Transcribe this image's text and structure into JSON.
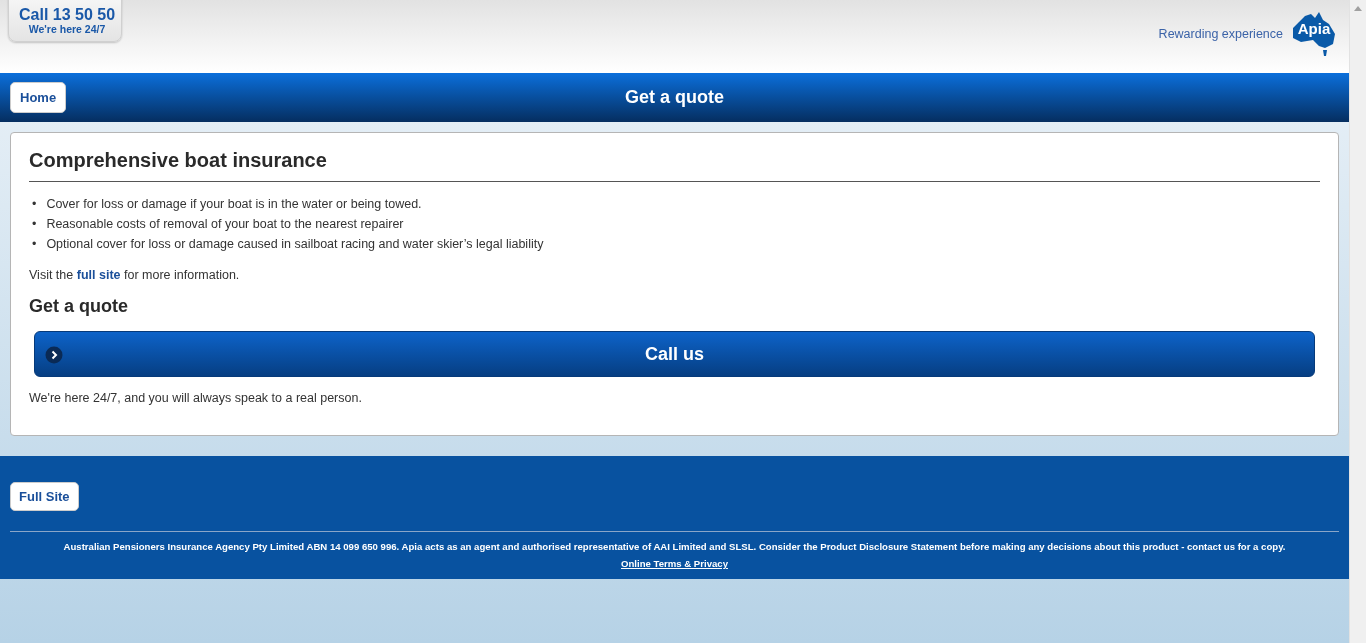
{
  "header": {
    "call_title": "Call 13 50 50",
    "call_subtitle": "We're here 24/7",
    "tagline": "Rewarding experience",
    "logo_text": "Apia"
  },
  "nav": {
    "home_button": "Home",
    "title": "Get a quote"
  },
  "content": {
    "heading": "Comprehensive boat insurance",
    "bullets": [
      {
        "marker": "•",
        "text": "Cover for loss or damage if your boat is in the water or being towed."
      },
      {
        "marker": "•",
        "text": "Reasonable costs of removal of your boat to the nearest repairer"
      },
      {
        "marker": "•",
        "text": "Optional cover for loss or damage caused in sailboat racing and water skier’s legal liability"
      }
    ],
    "visit": {
      "before": "Visit the",
      "link": "full site",
      "after": "for more information."
    },
    "quote_heading": "Get a quote",
    "call_button": "Call us",
    "note": "We're here 24/7, and you will always speak to a real person."
  },
  "footer": {
    "full_site_button": "Full Site",
    "disclaimer": "Australian Pensioners Insurance Agency Pty Limited ABN 14 099 650 996. Apia acts as an agent and authorised representative of AAI Limited and SLSL. Consider the Product Disclosure Statement before making any decisions about this product - contact us for a copy.",
    "terms_link": "Online Terms & Privacy"
  }
}
